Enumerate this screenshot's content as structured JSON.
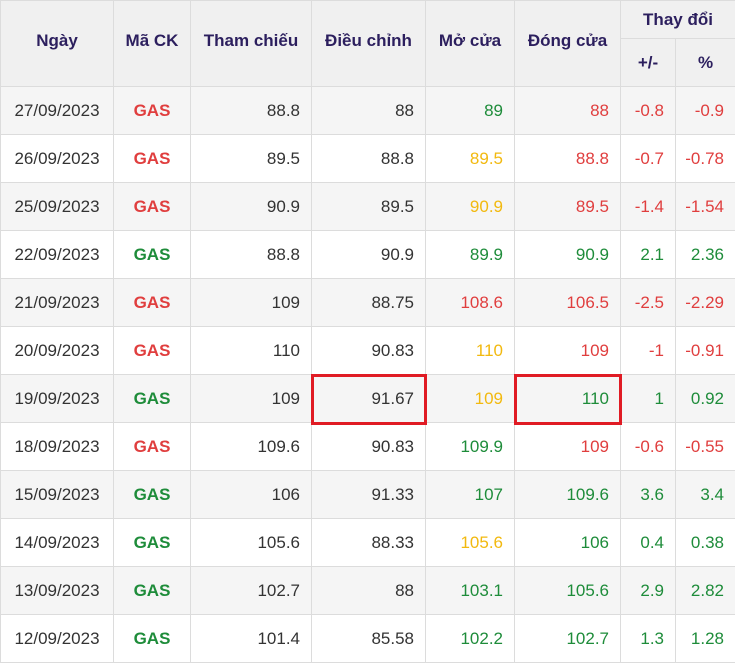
{
  "headers": {
    "date": "Ngày",
    "ticker": "Mã CK",
    "ref": "Tham chiếu",
    "adj": "Điều chỉnh",
    "open": "Mở cửa",
    "close": "Đóng cửa",
    "change": "Thay đổi",
    "change_abs": "+/-",
    "change_pct": "%"
  },
  "colors": {
    "red": "#e03e3e",
    "green": "#1e8c3a",
    "yellow": "#f2b90f",
    "highlight": "#e01b24"
  },
  "rows": [
    {
      "date": "27/09/2023",
      "ticker": "GAS",
      "ticker_color": "red",
      "ref": "88.8",
      "adj": "88",
      "open": "89",
      "open_color": "green",
      "close": "88",
      "close_color": "red",
      "chg": "-0.8",
      "pct": "-0.9",
      "chg_color": "red"
    },
    {
      "date": "26/09/2023",
      "ticker": "GAS",
      "ticker_color": "red",
      "ref": "89.5",
      "adj": "88.8",
      "open": "89.5",
      "open_color": "yellow",
      "close": "88.8",
      "close_color": "red",
      "chg": "-0.7",
      "pct": "-0.78",
      "chg_color": "red"
    },
    {
      "date": "25/09/2023",
      "ticker": "GAS",
      "ticker_color": "red",
      "ref": "90.9",
      "adj": "89.5",
      "open": "90.9",
      "open_color": "yellow",
      "close": "89.5",
      "close_color": "red",
      "chg": "-1.4",
      "pct": "-1.54",
      "chg_color": "red"
    },
    {
      "date": "22/09/2023",
      "ticker": "GAS",
      "ticker_color": "green",
      "ref": "88.8",
      "adj": "90.9",
      "open": "89.9",
      "open_color": "green",
      "close": "90.9",
      "close_color": "green",
      "chg": "2.1",
      "pct": "2.36",
      "chg_color": "green"
    },
    {
      "date": "21/09/2023",
      "ticker": "GAS",
      "ticker_color": "red",
      "ref": "109",
      "adj": "88.75",
      "open": "108.6",
      "open_color": "red",
      "close": "106.5",
      "close_color": "red",
      "chg": "-2.5",
      "pct": "-2.29",
      "chg_color": "red"
    },
    {
      "date": "20/09/2023",
      "ticker": "GAS",
      "ticker_color": "red",
      "ref": "110",
      "adj": "90.83",
      "open": "110",
      "open_color": "yellow",
      "close": "109",
      "close_color": "red",
      "chg": "-1",
      "pct": "-0.91",
      "chg_color": "red"
    },
    {
      "date": "19/09/2023",
      "ticker": "GAS",
      "ticker_color": "green",
      "ref": "109",
      "adj": "91.67",
      "open": "109",
      "open_color": "yellow",
      "close": "110",
      "close_color": "green",
      "chg": "1",
      "pct": "0.92",
      "chg_color": "green"
    },
    {
      "date": "18/09/2023",
      "ticker": "GAS",
      "ticker_color": "red",
      "ref": "109.6",
      "adj": "90.83",
      "open": "109.9",
      "open_color": "green",
      "close": "109",
      "close_color": "red",
      "chg": "-0.6",
      "pct": "-0.55",
      "chg_color": "red"
    },
    {
      "date": "15/09/2023",
      "ticker": "GAS",
      "ticker_color": "green",
      "ref": "106",
      "adj": "91.33",
      "open": "107",
      "open_color": "green",
      "close": "109.6",
      "close_color": "green",
      "chg": "3.6",
      "pct": "3.4",
      "chg_color": "green"
    },
    {
      "date": "14/09/2023",
      "ticker": "GAS",
      "ticker_color": "green",
      "ref": "105.6",
      "adj": "88.33",
      "open": "105.6",
      "open_color": "yellow",
      "close": "106",
      "close_color": "green",
      "chg": "0.4",
      "pct": "0.38",
      "chg_color": "green"
    },
    {
      "date": "13/09/2023",
      "ticker": "GAS",
      "ticker_color": "green",
      "ref": "102.7",
      "adj": "88",
      "open": "103.1",
      "open_color": "green",
      "close": "105.6",
      "close_color": "green",
      "chg": "2.9",
      "pct": "2.82",
      "chg_color": "green"
    },
    {
      "date": "12/09/2023",
      "ticker": "GAS",
      "ticker_color": "green",
      "ref": "101.4",
      "adj": "85.58",
      "open": "102.2",
      "open_color": "green",
      "close": "102.7",
      "close_color": "green",
      "chg": "1.3",
      "pct": "1.28",
      "chg_color": "green"
    }
  ],
  "highlighted_cells": [
    {
      "row": 6,
      "column": "adj"
    },
    {
      "row": 6,
      "column": "close"
    }
  ]
}
